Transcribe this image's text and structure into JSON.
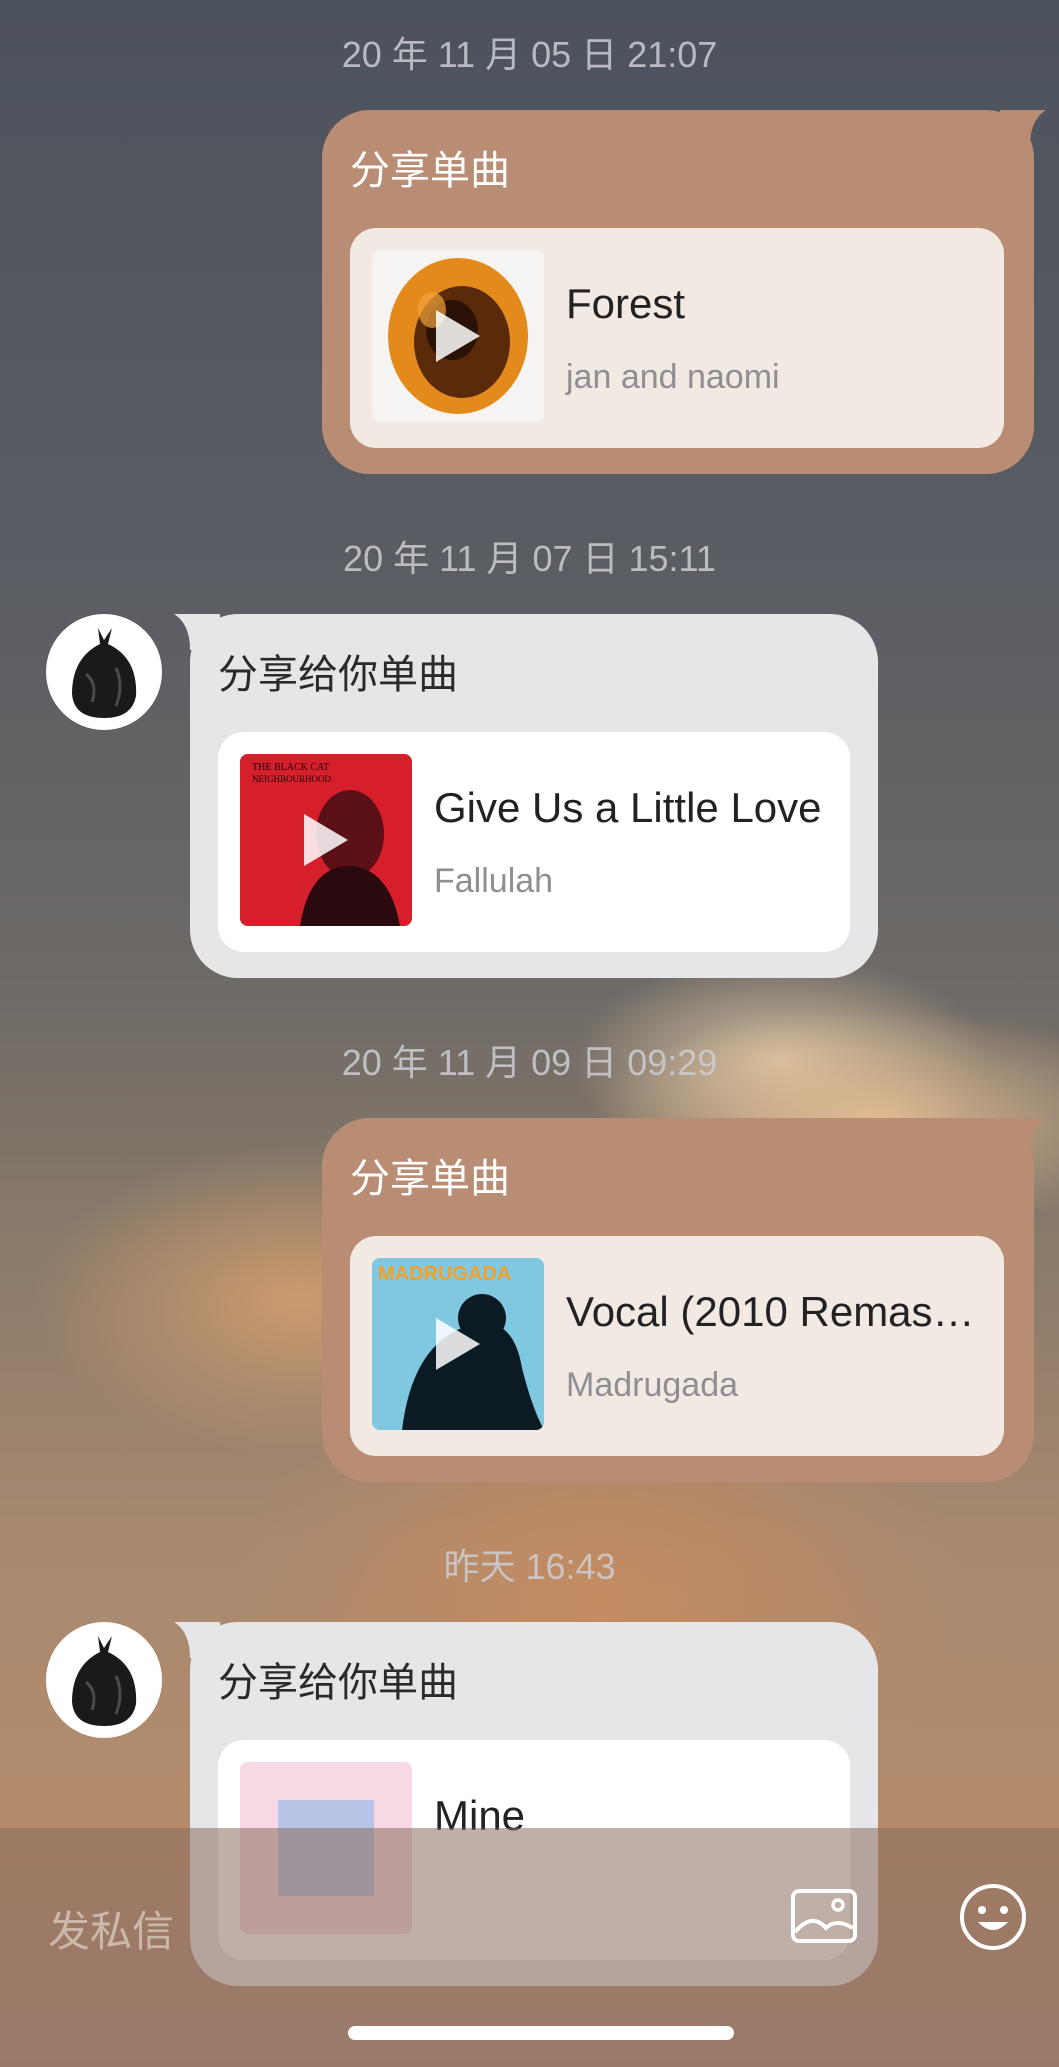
{
  "messages": [
    {
      "timestamp": "20 年 11 月 05 日  21:07",
      "direction": "sent",
      "title": "分享单曲",
      "song": "Forest",
      "artist": "jan and naomi"
    },
    {
      "timestamp": "20 年 11 月 07 日  15:11",
      "direction": "received",
      "title": "分享给你单曲",
      "song": "Give Us a Little Love",
      "artist": "Fallulah",
      "cover_text_line1": "THE BLACK CAT",
      "cover_text_line2": "NEIGHBOURHOOD"
    },
    {
      "timestamp": "20 年 11 月 09 日  09:29",
      "direction": "sent",
      "title": "分享单曲",
      "song": "Vocal (2010 Remast…",
      "artist": "Madrugada",
      "cover_text": "MADRUGADA"
    },
    {
      "timestamp": "昨天  16:43",
      "direction": "received",
      "title": "分享给你单曲",
      "song": "Mine",
      "artist": ""
    }
  ],
  "input": {
    "placeholder": "发私信"
  },
  "icons": {
    "image": "image-icon",
    "emoji": "emoji-icon",
    "avatar": "trash-bag-avatar"
  },
  "colors": {
    "sent_bubble": "#b98d73",
    "received_bubble": "#e6e6e9",
    "sent_card": "#f3e9e3"
  }
}
